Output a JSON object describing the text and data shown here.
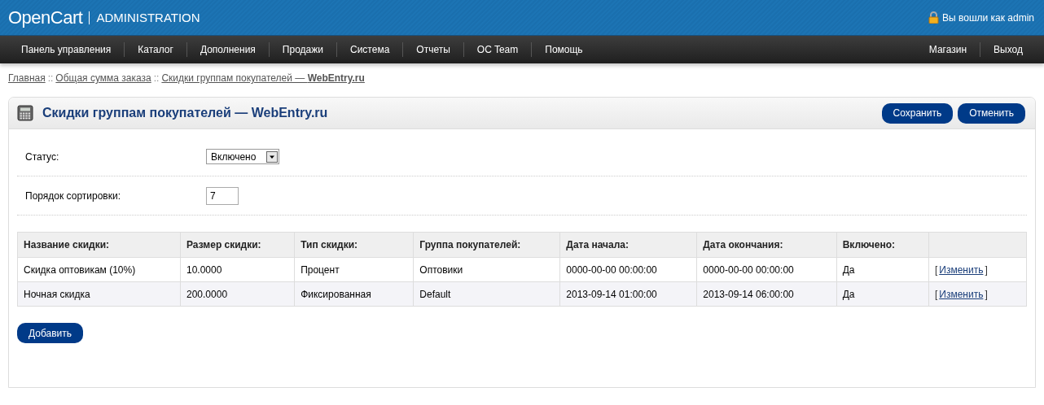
{
  "header": {
    "logo": "OpenCart",
    "subtitle": "ADMINISTRATION",
    "user": "Вы вошли как admin"
  },
  "menu": {
    "left": [
      "Панель управления",
      "Каталог",
      "Дополнения",
      "Продажи",
      "Система",
      "Отчеты",
      "OC Team",
      "Помощь"
    ],
    "right": [
      "Магазин",
      "Выход"
    ]
  },
  "breadcrumb": {
    "separator": "::",
    "items": [
      {
        "label": "Главная"
      },
      {
        "label": "Общая сумма заказа"
      },
      {
        "label": "Скидки группам покупателей — **WebEntry.ru**"
      }
    ]
  },
  "box": {
    "title": "Скидки группам покупателей — WebEntry.ru",
    "buttons": [
      "Сохранить",
      "Отменить"
    ]
  },
  "form": {
    "status_label": "Статус:",
    "status_value": "Включено",
    "sort_label": "Порядок сортировки:",
    "sort_value": "7"
  },
  "table": {
    "columns": [
      "Название скидки:",
      "Размер скидки:",
      "Тип скидки:",
      "Группа покупателей:",
      "Дата начала:",
      "Дата окончания:",
      "Включено:"
    ],
    "rows": [
      {
        "cells": [
          "Скидка оптовикам (10%)",
          "10.0000",
          "Процент",
          "Оптовики",
          "0000-00-00 00:00:00",
          "0000-00-00 00:00:00",
          "Да"
        ],
        "action": {
          "open": "[",
          "label": "Изменить",
          "close": "]"
        }
      },
      {
        "cells": [
          "Ночная скидка",
          "200.0000",
          "Фиксированная",
          "Default",
          "2013-09-14 01:00:00",
          "2013-09-14 06:00:00",
          "Да"
        ],
        "action": {
          "open": "[",
          "label": "Изменить",
          "close": "]"
        }
      }
    ]
  },
  "add_button": "Добавить"
}
